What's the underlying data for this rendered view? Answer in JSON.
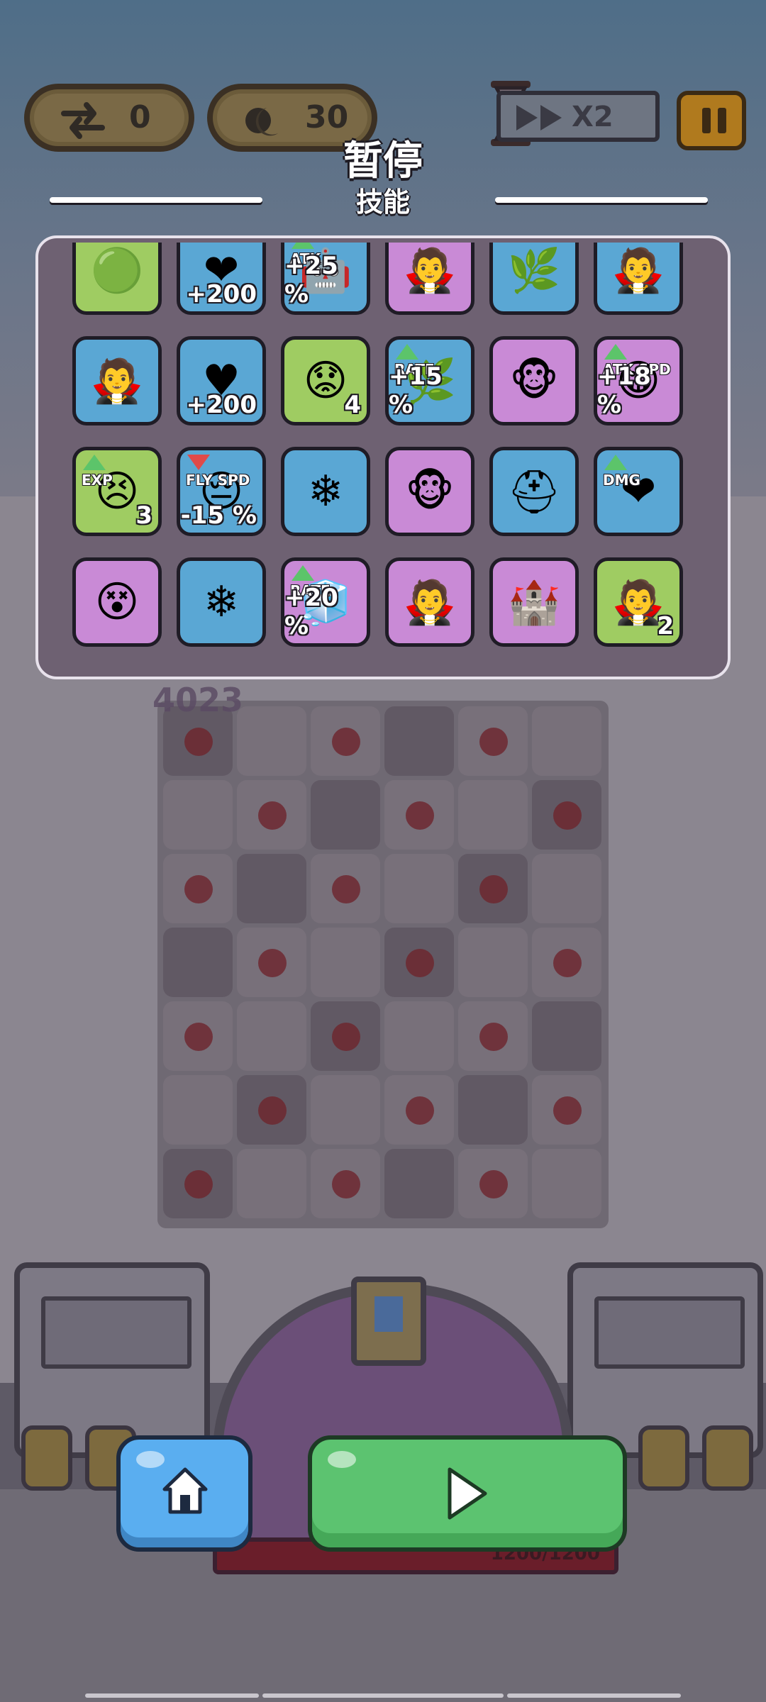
{
  "hud": {
    "swap_count": "0",
    "energy_count": "30",
    "speed_label": "X2"
  },
  "overlay": {
    "title": "暂停",
    "section_label": "技能"
  },
  "scene": {
    "score_text": "4023",
    "hp_text": "1200/1200"
  },
  "skills": [
    {
      "name": "slime-summon-skill",
      "bg": "green",
      "icon": "slime-group-icon",
      "value": "",
      "tag": ""
    },
    {
      "name": "heal-wings-skill",
      "bg": "blue",
      "icon": "winged-heart-icon",
      "value": "+200",
      "tag": ""
    },
    {
      "name": "atk-boost-skill",
      "bg": "blue",
      "icon": "robot-atk-icon",
      "value": "+25 %",
      "tag": "ATK"
    },
    {
      "name": "vampire-bats-skill",
      "bg": "purple",
      "icon": "vampire-icon",
      "value": "",
      "tag": ""
    },
    {
      "name": "vine-trap-skill",
      "bg": "blue",
      "icon": "vine-face-icon",
      "value": "",
      "tag": ""
    },
    {
      "name": "vampire-bats-skill-2",
      "bg": "blue",
      "icon": "vampire-icon",
      "value": "",
      "tag": ""
    },
    {
      "name": "vampire-bat-skill",
      "bg": "blue",
      "icon": "vampire-icon",
      "value": "",
      "tag": ""
    },
    {
      "name": "heart-hp-skill",
      "bg": "blue",
      "icon": "heart-hp-icon",
      "value": "+200",
      "tag": ""
    },
    {
      "name": "blood-face-skill",
      "bg": "green",
      "icon": "sad-face-icon",
      "value": "4",
      "tag": ""
    },
    {
      "name": "vine-rate-skill",
      "bg": "blue",
      "icon": "vine-rate-icon",
      "value": "+15 %",
      "tag": "RATE"
    },
    {
      "name": "monkey-spear-skill",
      "bg": "purple",
      "icon": "monkey-spear-icon",
      "value": "",
      "tag": ""
    },
    {
      "name": "atk-spd-skill",
      "bg": "purple",
      "icon": "emoji-group-icon",
      "value": "+18 %",
      "tag": "ATK SPD"
    },
    {
      "name": "exp-boost-skill",
      "bg": "green",
      "icon": "exp-face-icon",
      "value": "3",
      "tag": "EXP"
    },
    {
      "name": "fly-spd-skill",
      "bg": "blue",
      "icon": "fly-spd-icon",
      "value": "-15 %",
      "tag": "FLY SPD"
    },
    {
      "name": "ice-crystal-skill",
      "bg": "blue",
      "icon": "ice-crystal-icon",
      "value": "",
      "tag": ""
    },
    {
      "name": "monkey-spear-swap-skill",
      "bg": "purple",
      "icon": "monkey-swap-icon",
      "value": "",
      "tag": ""
    },
    {
      "name": "knight-area-skill",
      "bg": "blue",
      "icon": "knight-area-icon",
      "value": "",
      "tag": ""
    },
    {
      "name": "dmg-heart-skill",
      "bg": "blue",
      "icon": "dmg-heart-icon",
      "value": "",
      "tag": "DMG"
    },
    {
      "name": "stun-stars-skill",
      "bg": "purple",
      "icon": "dizzy-face-icon",
      "value": "",
      "tag": ""
    },
    {
      "name": "ice-freeze-skill",
      "bg": "blue",
      "icon": "ice-freeze-icon",
      "value": "",
      "tag": ""
    },
    {
      "name": "rate-boost-skill",
      "bg": "purple",
      "icon": "rate-face-icon",
      "value": "+20 %",
      "tag": "RATE"
    },
    {
      "name": "vampire-swap-skill",
      "bg": "purple",
      "icon": "vampire-swap-icon",
      "value": "",
      "tag": ""
    },
    {
      "name": "slime-gate-skill",
      "bg": "purple",
      "icon": "slime-gate-icon",
      "value": "",
      "tag": ""
    },
    {
      "name": "vampire-plus-skill",
      "bg": "green",
      "icon": "vampire-plus-icon",
      "value": "2",
      "tag": ""
    }
  ],
  "colors": {
    "green_tile": "#9fcc62",
    "blue_tile": "#5aa7d4",
    "purple_tile": "#c98ad6",
    "panel": "#6e6172",
    "home_button": "#5aaef0",
    "play_button": "#5cc370"
  }
}
